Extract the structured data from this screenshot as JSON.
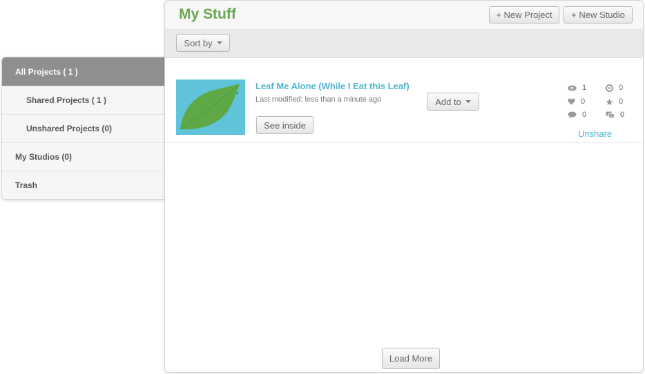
{
  "sidebar": {
    "items": [
      {
        "label": "All Projects ( 1 )",
        "active": true
      },
      {
        "label": "Shared Projects ( 1 )"
      },
      {
        "label": "Unshared Projects (0)"
      },
      {
        "label": "My Studios (0)"
      },
      {
        "label": "Trash"
      }
    ]
  },
  "header": {
    "title": "My Stuff",
    "new_project_label": "+ New Project",
    "new_studio_label": "+ New Studio"
  },
  "toolbar": {
    "sort_label": "Sort by"
  },
  "project": {
    "title": "Leaf Me Alone (While I Eat this Leaf)",
    "modified": "Last modified: less than a minute ago",
    "see_inside_label": "See inside",
    "add_to_label": "Add to",
    "unshare_label": "Unshare",
    "stats": {
      "views": "1",
      "remixes": "0",
      "loves": "0",
      "favorites": "0",
      "comments": "0",
      "studios": "0"
    },
    "thumbnail_colors": {
      "background": "#5fc3d9",
      "leaf": "#5ea846"
    }
  },
  "footer": {
    "load_more_label": "Load More"
  },
  "colors": {
    "accent_green": "#6aa84f",
    "link_blue": "#4fb5cf",
    "active_tab": "#8f8f8f"
  },
  "icons": [
    "eye-icon",
    "remix-icon",
    "heart-icon",
    "star-icon",
    "comment-icon",
    "studio-icon",
    "chevron-down-icon"
  ]
}
